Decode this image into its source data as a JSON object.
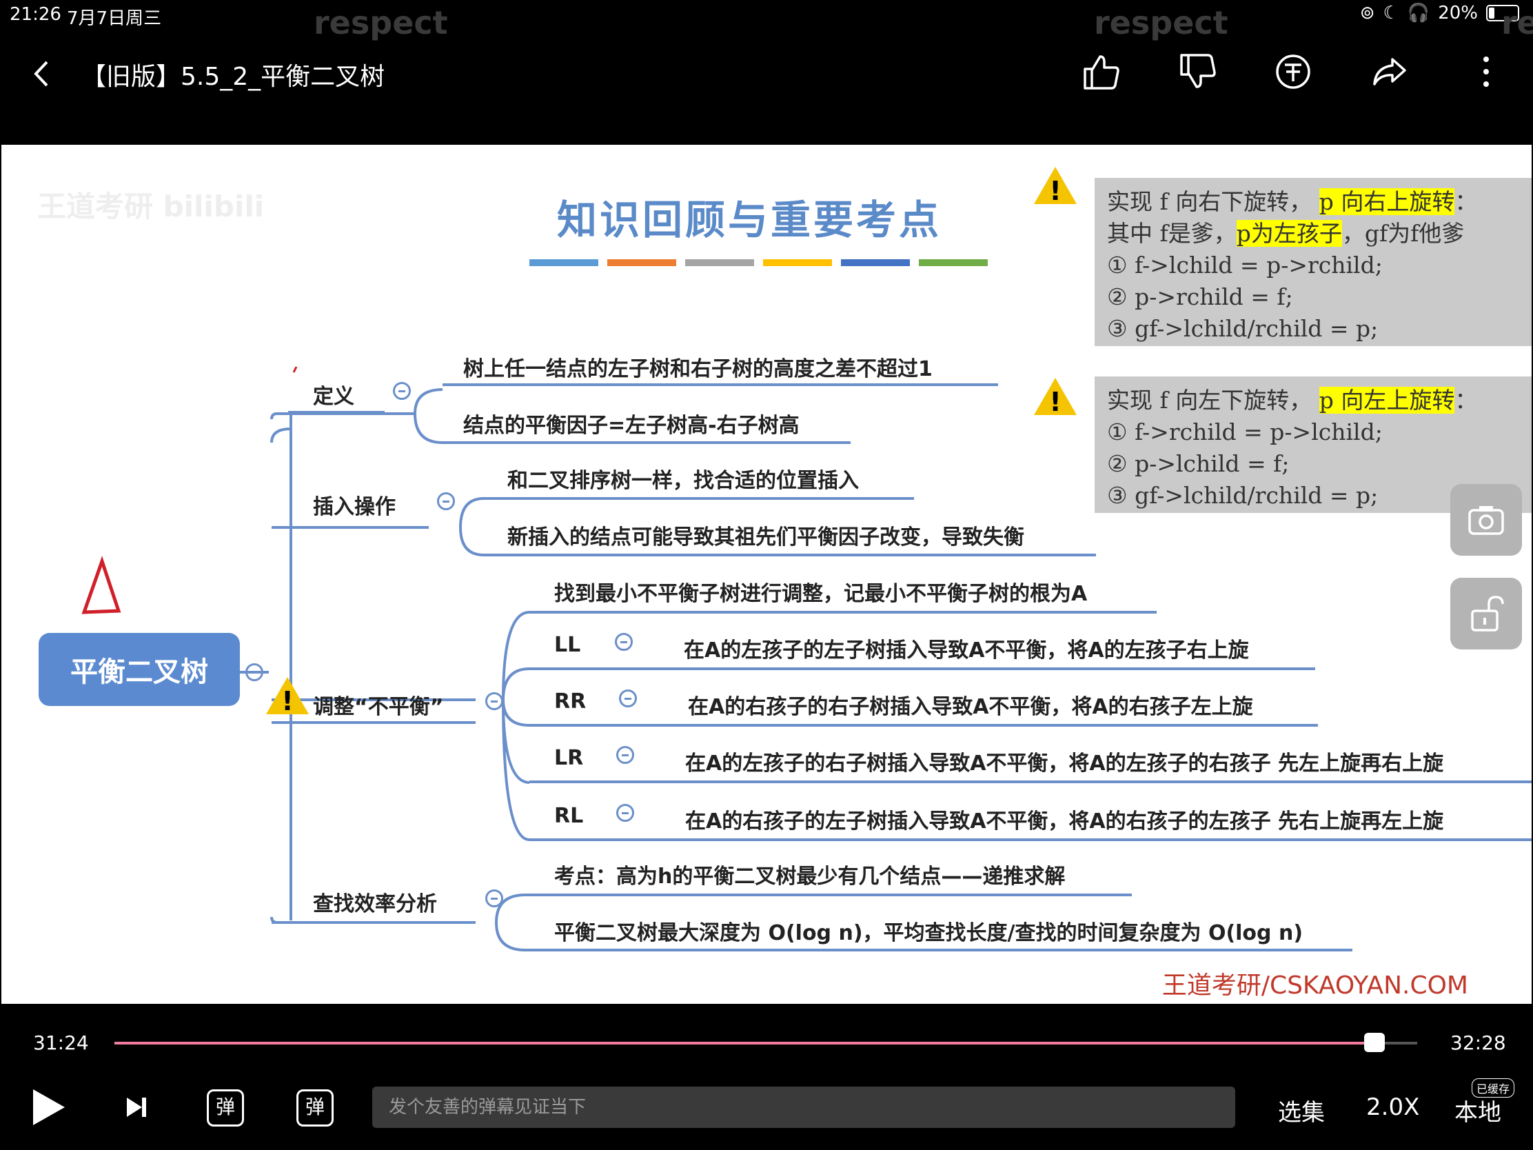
{
  "status_bar": {
    "time": "21:26",
    "date": "7月7日周三",
    "battery": "20%",
    "battery_level": 0.2
  },
  "watermarks": [
    "respect",
    "respect",
    "resp"
  ],
  "header": {
    "title": "【旧版】5.5_2_平衡二叉树",
    "icons": [
      "back-icon",
      "thumbs-up-icon",
      "thumbs-down-icon",
      "coin-icon",
      "share-icon",
      "more-icon"
    ]
  },
  "slide": {
    "title": "知识回顾与重要考点",
    "title_bar_colors": [
      "#5b9bd5",
      "#ed7d31",
      "#a5a5a5",
      "#ffc000",
      "#4472c4",
      "#70ad47"
    ],
    "root": "平衡二叉树",
    "hand_mark": "△",
    "branches": {
      "definition": {
        "label": "定义",
        "items": [
          "树上任一结点的左子树和右子树的高度之差不超过1",
          "结点的平衡因子=左子树高-右子树高"
        ]
      },
      "insert": {
        "label": "插入操作",
        "items": [
          "和二叉排序树一样，找合适的位置插入",
          "新插入的结点可能导致其祖先们平衡因子改变，导致失衡"
        ]
      },
      "adjust": {
        "label": "调整“不平衡”",
        "intro": "找到最小不平衡子树进行调整，记最小不平衡子树的根为A",
        "cases": [
          {
            "name": "LL",
            "text": "在A的左孩子的左子树插入导致A不平衡，将A的左孩子右上旋"
          },
          {
            "name": "RR",
            "text": "在A的右孩子的右子树插入导致A不平衡，将A的右孩子左上旋"
          },
          {
            "name": "LR",
            "text": "在A的左孩子的右子树插入导致A不平衡，将A的左孩子的右孩子 先左上旋再右上旋"
          },
          {
            "name": "RL",
            "text": "在A的右孩子的左子树插入导致A不平衡，将A的右孩子的左孩子 先右上旋再左上旋"
          }
        ]
      },
      "search": {
        "label": "查找效率分析",
        "items": [
          "考点：高为h的平衡二叉树最少有几个结点——递推求解",
          "平衡二叉树最大深度为 O(log n)，平均查找长度/查找的时间复杂度为 O(log n)"
        ]
      }
    },
    "note_right": {
      "l1a": "实现 f 向右下旋转，",
      "l1b": "p 向右上旋转",
      "l1c": "：",
      "l2a": "其中 f是爹，",
      "l2b": "p为左孩子",
      "l2c": "，gf为f他爹",
      "lines": [
        "① f->lchild = p->rchild;",
        "② p->rchild = f;",
        "③ gf->lchild/rchild = p;"
      ]
    },
    "note_left": {
      "l1a": "实现 f 向左下旋转，",
      "l1b": "p 向左上旋转",
      "l1c": "：",
      "lines": [
        "① f->rchild = p->lchild;",
        "② p->lchild = f;",
        "③ gf->lchild/rchild = p;"
      ]
    },
    "credit": "王道考研/CSKAOYAN.COM",
    "logo": "王道考研 bilibili"
  },
  "player": {
    "current_time": "31:24",
    "total_time": "32:28",
    "progress": 0.967,
    "danmaku_placeholder": "发个友善的弹幕见证当下",
    "episodes": "选集",
    "speed": "2.0X",
    "local": "本地",
    "cache_badge": "已缓存",
    "danmaku_toggle": "弹",
    "danmaku_settings": "弹"
  }
}
